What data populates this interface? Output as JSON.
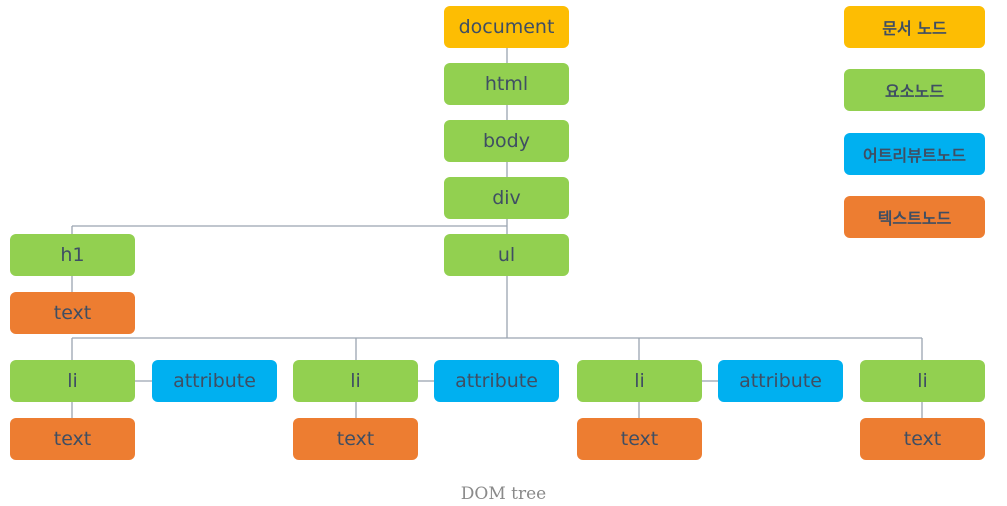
{
  "colors": {
    "document": "#fdbd03",
    "element": "#92d050",
    "attribute": "#00b0f0",
    "text": "#ed7d31",
    "connector": "#9aa5b1",
    "label": "#3f4e63"
  },
  "nodes": {
    "document": "document",
    "html": "html",
    "body": "body",
    "div": "div",
    "h1": "h1",
    "h1_text": "text",
    "ul": "ul",
    "li_1": "li",
    "li_1_attr": "attribute",
    "li_1_text": "text",
    "li_2": "li",
    "li_2_attr": "attribute",
    "li_2_text": "text",
    "li_3": "li",
    "li_3_attr": "attribute",
    "li_3_text": "text",
    "li_4": "li",
    "li_4_text": "text"
  },
  "legend": {
    "document": "문서 노드",
    "element": "요소노드",
    "attribute": "어트리뷰트노드",
    "text": "텍스트노드"
  },
  "caption": "DOM tree"
}
